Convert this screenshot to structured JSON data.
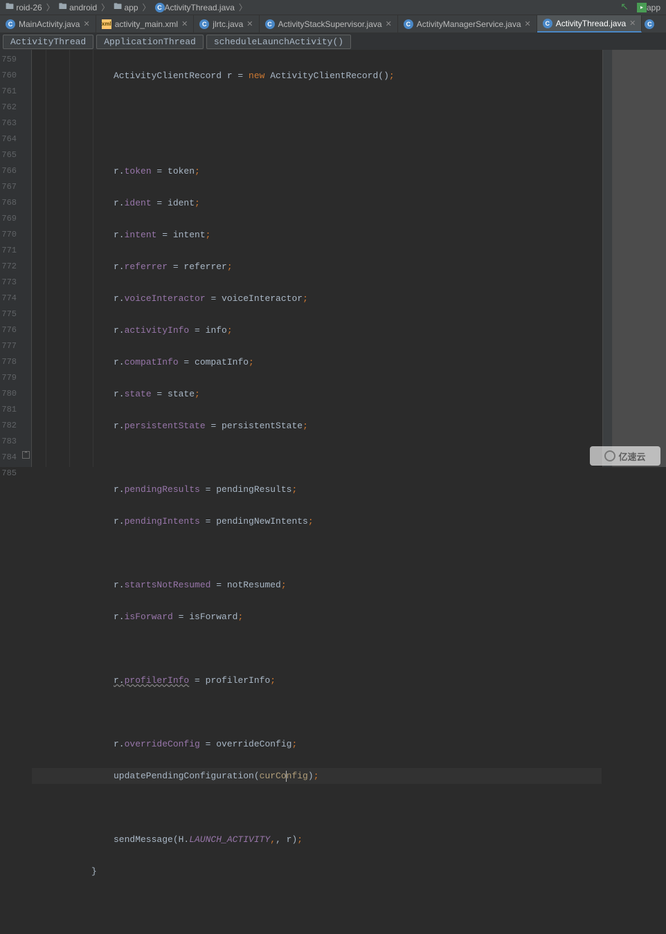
{
  "breadcrumb": {
    "items": [
      {
        "label": "roid-26",
        "icon": "folder"
      },
      {
        "label": "android",
        "icon": "folder"
      },
      {
        "label": "app",
        "icon": "folder"
      },
      {
        "label": "ActivityThread.java",
        "icon": "class"
      }
    ]
  },
  "topRight": {
    "runConfig": "app"
  },
  "tabs": [
    {
      "label": "MainActivity.java",
      "icon": "c",
      "active": false
    },
    {
      "label": "activity_main.xml",
      "icon": "xml",
      "active": false
    },
    {
      "label": "jlrtc.java",
      "icon": "c",
      "active": false
    },
    {
      "label": "ActivityStackSupervisor.java",
      "icon": "c",
      "active": false
    },
    {
      "label": "ActivityManagerService.java",
      "icon": "c",
      "active": false
    },
    {
      "label": "ActivityThread.java",
      "icon": "c",
      "active": true
    }
  ],
  "codeCrumbs": [
    "ActivityThread",
    "ApplicationThread",
    "scheduleLaunchActivity()"
  ],
  "gutter": {
    "start": 759,
    "lines": [
      "759",
      "760",
      "761",
      "762",
      "763",
      "764",
      "765",
      "766",
      "767",
      "768",
      "769",
      "770",
      "771",
      "772",
      "773",
      "774",
      "775",
      "776",
      "777",
      "778",
      "779",
      "780",
      "781",
      "782",
      "783",
      "784",
      "785"
    ]
  },
  "code": {
    "l759": {
      "t1": "ActivityClientRecord r = ",
      "kw": "new",
      "t2": " ActivityClientRecord()",
      "semi": ";"
    },
    "l762": {
      "r": "r.",
      "f": "token",
      "rest": " = token",
      "semi": ";"
    },
    "l763": {
      "r": "r.",
      "f": "ident",
      "rest": " = ident",
      "semi": ";"
    },
    "l764": {
      "r": "r.",
      "f": "intent",
      "rest": " = intent",
      "semi": ";"
    },
    "l765": {
      "r": "r.",
      "f": "referrer",
      "rest": " = referrer",
      "semi": ";"
    },
    "l766": {
      "r": "r.",
      "f": "voiceInteractor",
      "rest": " = voiceInteractor",
      "semi": ";"
    },
    "l767": {
      "r": "r.",
      "f": "activityInfo",
      "rest": " = info",
      "semi": ";"
    },
    "l768": {
      "r": "r.",
      "f": "compatInfo",
      "rest": " = compatInfo",
      "semi": ";"
    },
    "l769": {
      "r": "r.",
      "f": "state",
      "rest": " = state",
      "semi": ";"
    },
    "l770": {
      "r": "r.",
      "f": "persistentState",
      "rest": " = persistentState",
      "semi": ";"
    },
    "l772": {
      "r": "r.",
      "f": "pendingResults",
      "rest": " = pendingResults",
      "semi": ";"
    },
    "l773": {
      "r": "r.",
      "f": "pendingIntents",
      "rest": " = pendingNewIntents",
      "semi": ";"
    },
    "l775": {
      "r": "r.",
      "f": "startsNotResumed",
      "rest": " = notResumed",
      "semi": ";"
    },
    "l776": {
      "r": "r.",
      "f": "isForward",
      "rest": " = isForward",
      "semi": ";"
    },
    "l778": {
      "r": "r.",
      "f": "profilerInfo",
      "rest": " = profilerInfo",
      "semi": ";"
    },
    "l780": {
      "r": "r.",
      "f": "overrideConfig",
      "rest": " = overrideConfig",
      "semi": ";"
    },
    "l781": {
      "t1": "updatePendingConfiguration(",
      "p": "curConfig",
      "t2": ")",
      "semi": ";"
    },
    "l783": {
      "t1": "sendMessage(H.",
      "c": "LAUNCH_ACTIVITY",
      "t2": ", r)",
      "semi": ";"
    },
    "l784": {
      "brace": "}"
    }
  },
  "watermark": "亿速云"
}
